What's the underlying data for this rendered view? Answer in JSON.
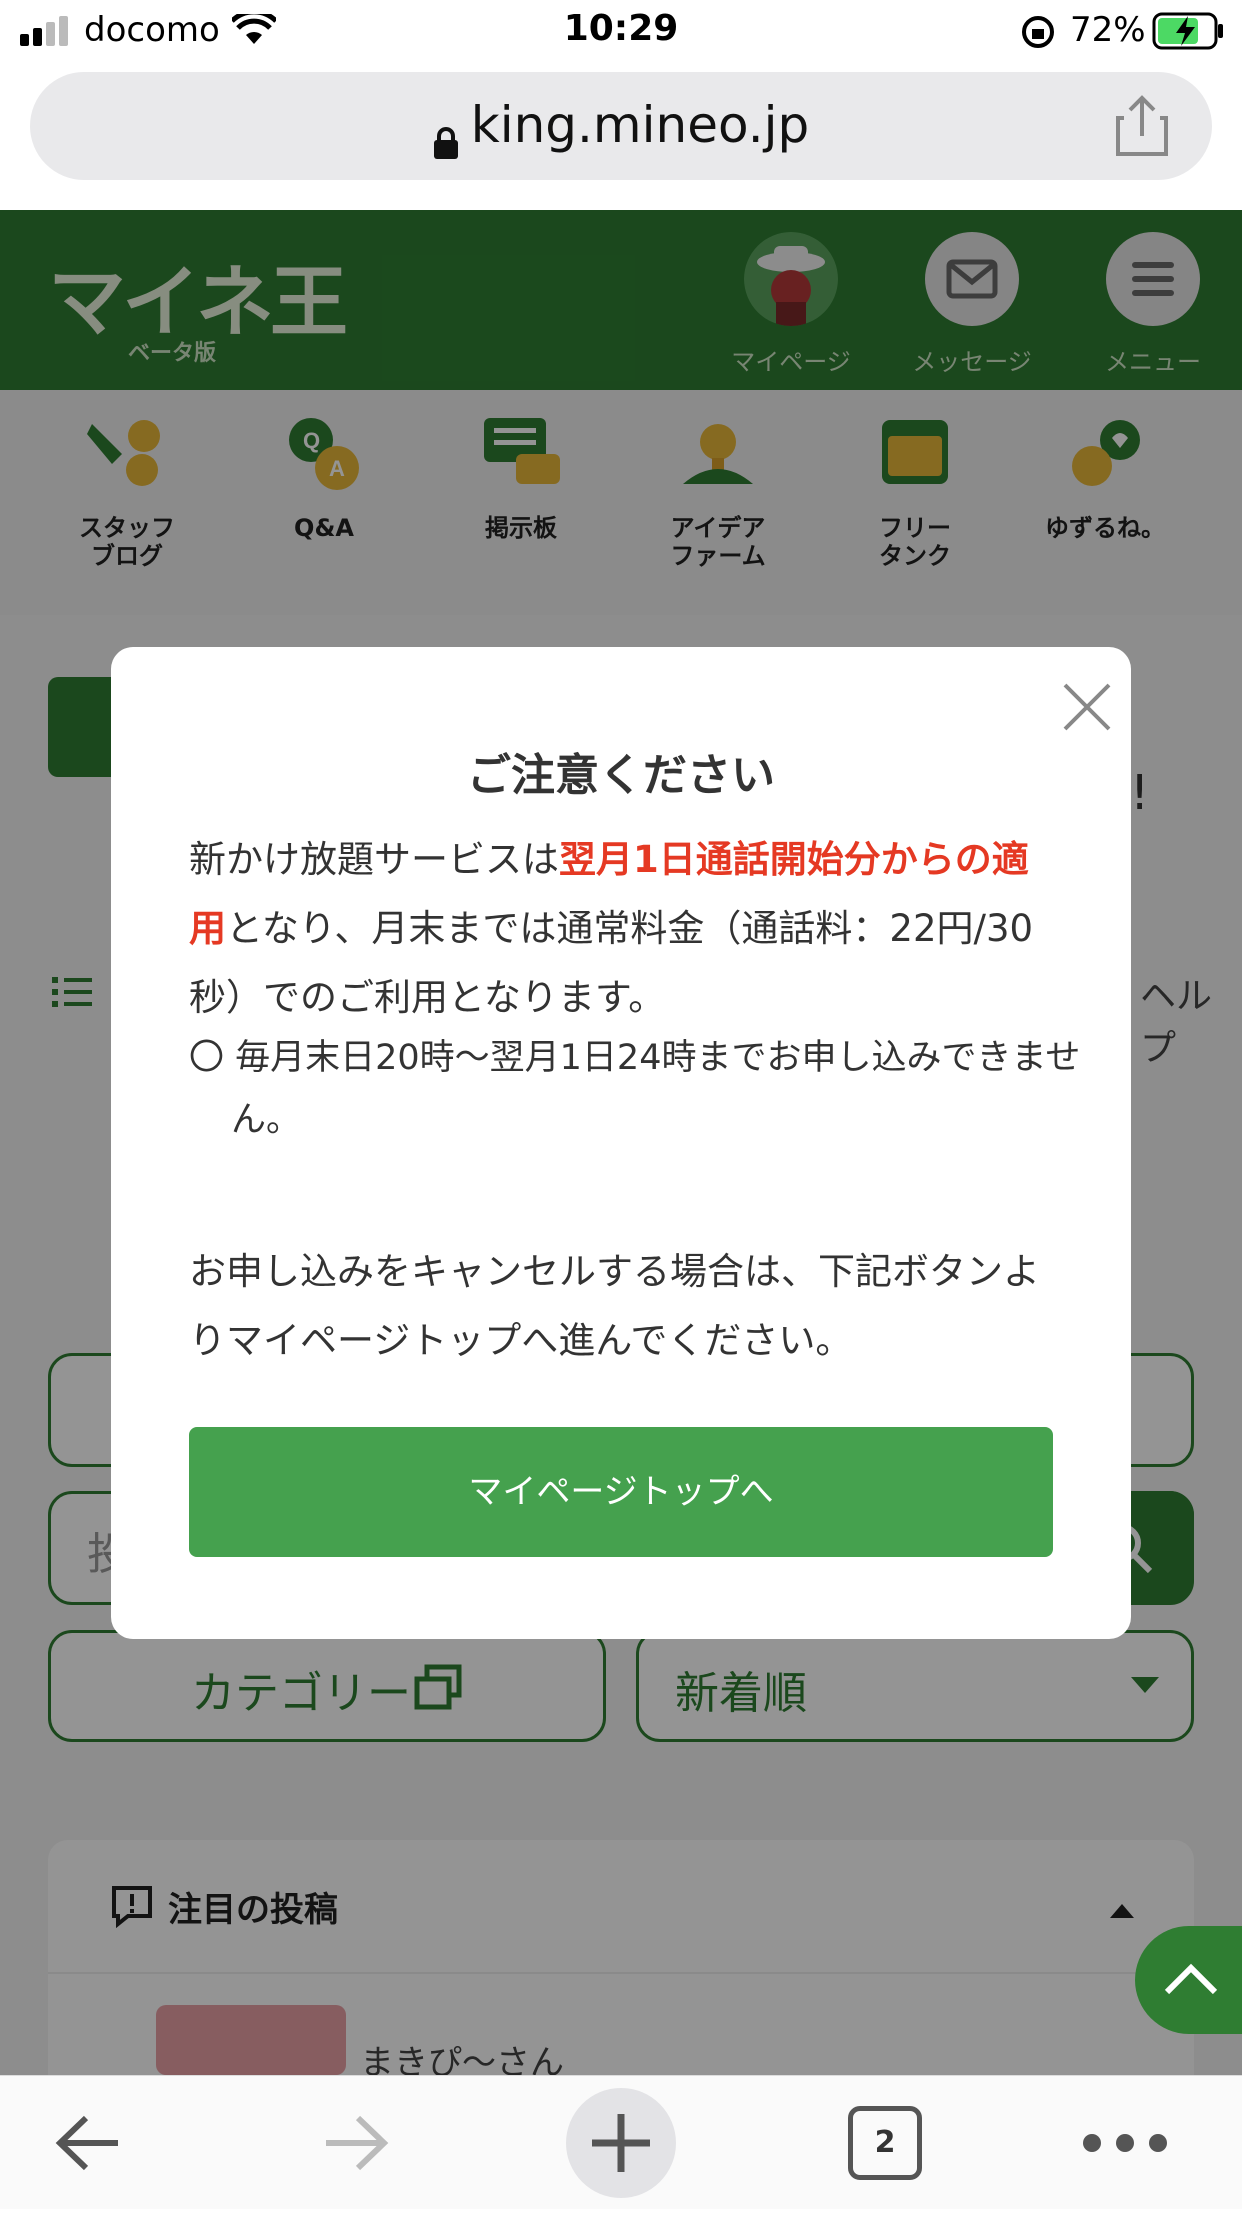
{
  "status_bar": {
    "carrier": "docomo",
    "time": "10:29",
    "battery": "72%"
  },
  "browser": {
    "url": "king.mineo.jp",
    "tab_count": "2"
  },
  "site": {
    "logo": "マイネ王",
    "beta_label": "ベータ版",
    "header_nav": {
      "mypage": "マイページ",
      "message": "メッセージ",
      "menu": "メニュー"
    },
    "quick_nav": [
      {
        "label": "スタッフ\nブログ",
        "icon": "staff-blog-icon"
      },
      {
        "label": "Q&A",
        "icon": "qa-icon"
      },
      {
        "label": "掲示板",
        "icon": "board-icon"
      },
      {
        "label": "アイデア\nファーム",
        "icon": "idea-icon"
      },
      {
        "label": "フリー\nタンク",
        "icon": "tank-icon"
      },
      {
        "label": "ゆずるね。",
        "icon": "yuzurune-icon"
      }
    ],
    "background": {
      "help_label": "ヘルプ",
      "exclaim": "!",
      "search_placeholder": "投",
      "category_button": "カテゴリー",
      "sort_select": "新着順",
      "trending_title": "注目の投稿",
      "post_user": "まきぴ〜さん"
    }
  },
  "modal": {
    "title": "ご注意ください",
    "body_prefix": "新かけ放題サービスは",
    "body_emphasis": "翌月1日通話開始分からの適用",
    "body_suffix": "となり、月末までは通常料金（通話料：22円/30秒）でのご利用となります。",
    "note": "〇 毎月末日20時〜翌月1日24時までお申し込みできません。",
    "cancel_text": "お申し込みをキャンセルする場合は、下記ボタンよりマイページトップへ進んでください。",
    "button_label": "マイページトップへ"
  },
  "colors": {
    "brand_green": "#2f7d32",
    "button_green": "#45a14e",
    "emphasis_red": "#e53923"
  }
}
